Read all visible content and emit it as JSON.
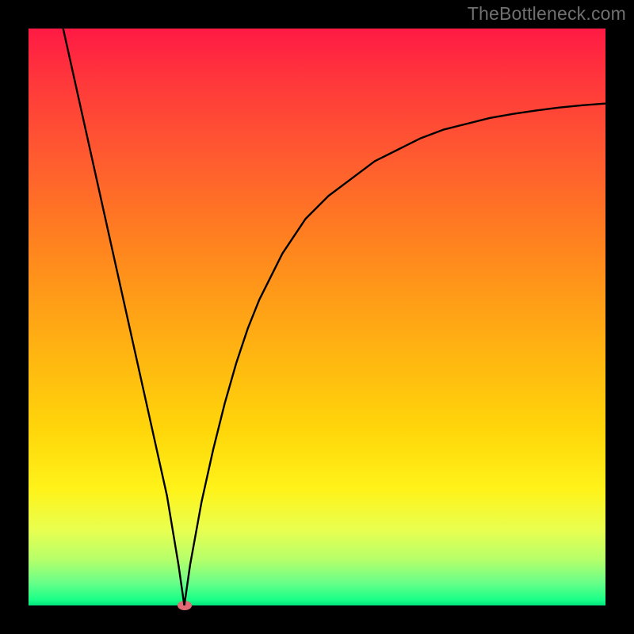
{
  "watermark": "TheBottleneck.com",
  "chart_data": {
    "type": "line",
    "title": "",
    "xlabel": "",
    "ylabel": "",
    "xlim": [
      0,
      100
    ],
    "ylim": [
      0,
      100
    ],
    "grid": false,
    "legend": false,
    "annotations": [],
    "marker": {
      "x": 27,
      "y": 0,
      "color": "#e06a74"
    },
    "series": [
      {
        "name": "bottleneck-curve",
        "color": "#000000",
        "x": [
          6,
          8,
          10,
          12,
          14,
          16,
          18,
          20,
          22,
          24,
          26,
          27,
          28,
          30,
          32,
          34,
          36,
          38,
          40,
          44,
          48,
          52,
          56,
          60,
          64,
          68,
          72,
          76,
          80,
          84,
          88,
          92,
          96,
          100
        ],
        "y": [
          100,
          91,
          82,
          73,
          64,
          55,
          46,
          37,
          28,
          19,
          7,
          0,
          7,
          18,
          27,
          35,
          42,
          48,
          53,
          61,
          67,
          71,
          74,
          77,
          79,
          81,
          82.5,
          83.5,
          84.5,
          85.2,
          85.8,
          86.3,
          86.7,
          87
        ]
      }
    ],
    "background_gradient": {
      "top": "#ff1a44",
      "bottom": "#00e47d"
    }
  }
}
